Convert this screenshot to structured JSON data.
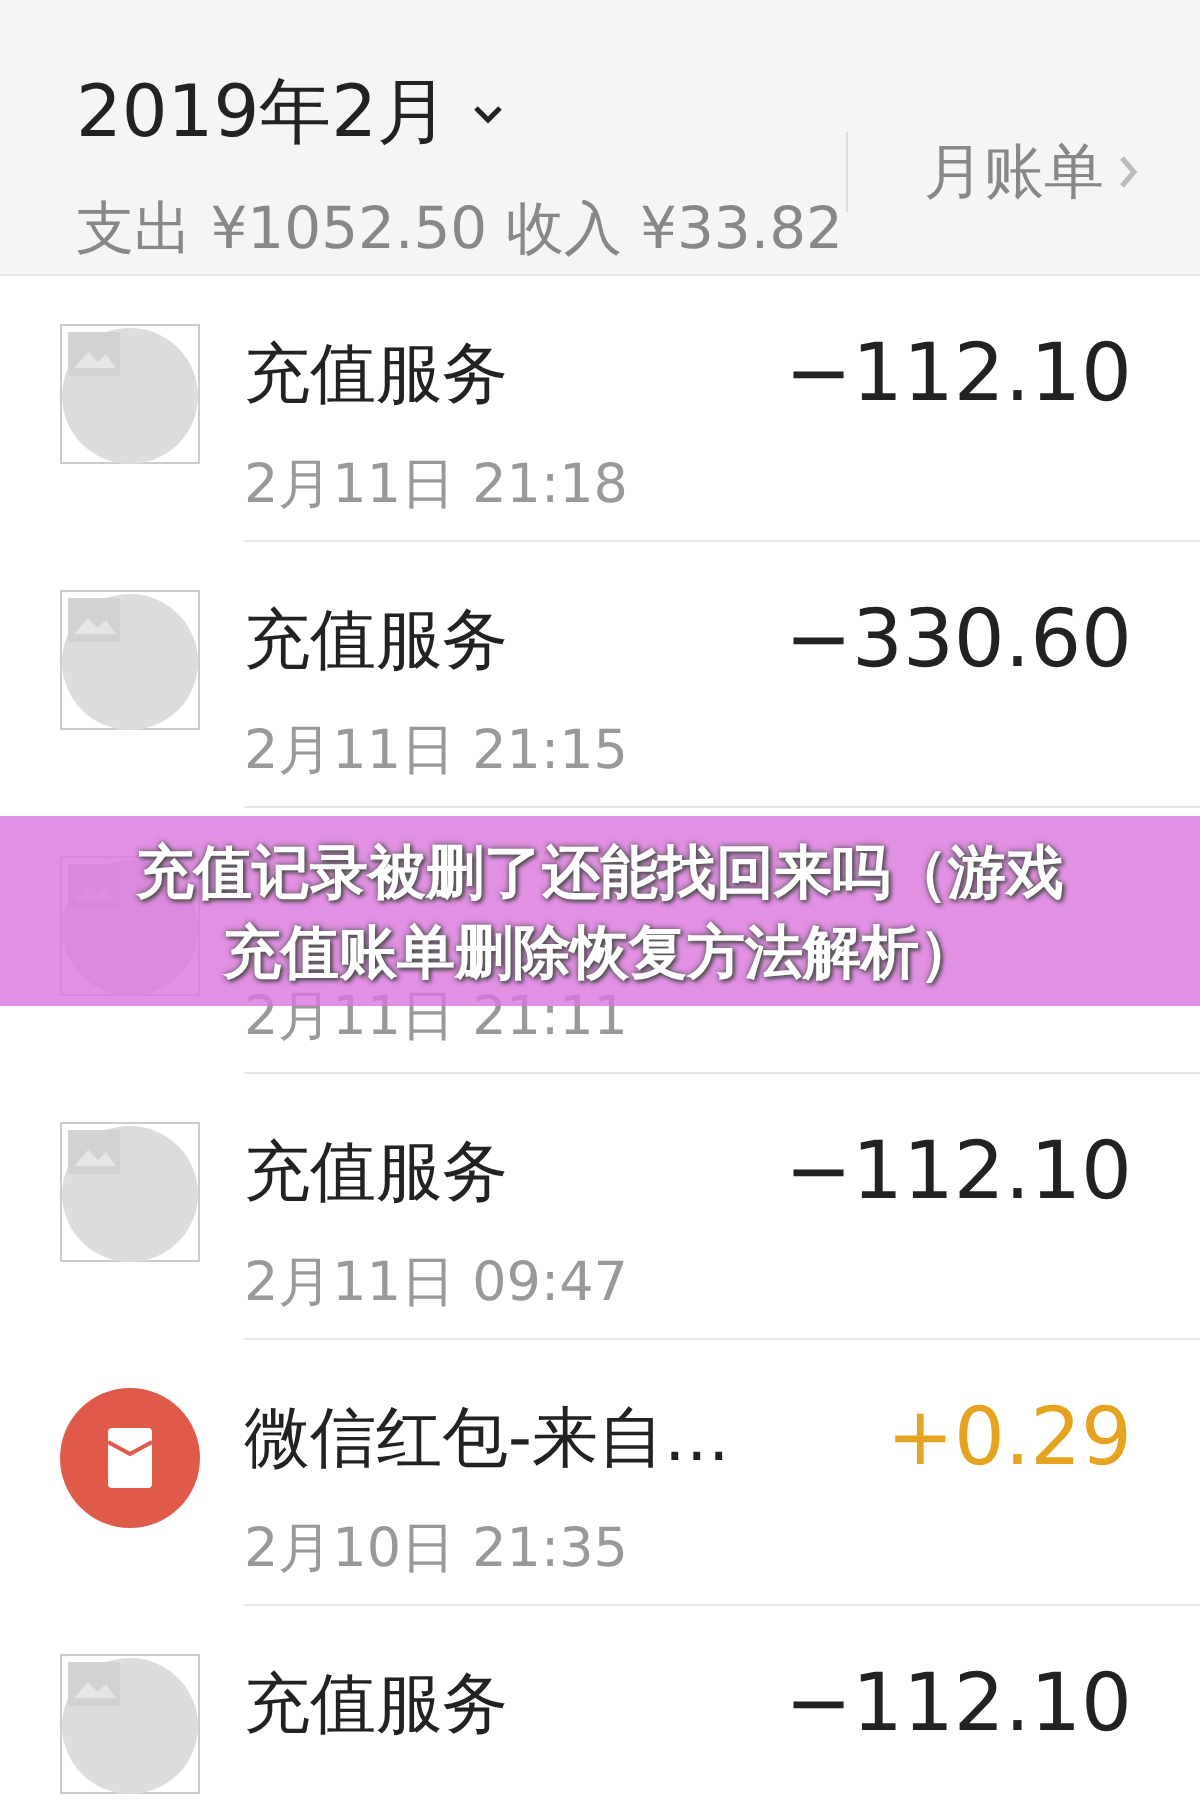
{
  "header": {
    "month": "2019年2月",
    "summary": "支出 ¥1052.50 收入 ¥33.82",
    "monthly_bill": "月账单"
  },
  "rows": [
    {
      "kind": "placeholder",
      "income": false,
      "title": "充值服务",
      "time": "2月11日 21:18",
      "amount": "−112.10"
    },
    {
      "kind": "placeholder",
      "income": false,
      "title": "充值服务",
      "time": "2月11日 21:15",
      "amount": "−330.60"
    },
    {
      "kind": "placeholder",
      "time": "2月11日 21:11"
    },
    {
      "kind": "placeholder",
      "income": false,
      "title": "充值服务",
      "time": "2月11日 09:47",
      "amount": "−112.10"
    },
    {
      "kind": "red-packet",
      "income": true,
      "title": "微信红包-来自…",
      "time": "2月10日 21:35",
      "amount": "+0.29"
    },
    {
      "kind": "placeholder",
      "income": false,
      "title": "充值服务",
      "amount": "−112.10"
    }
  ],
  "banner": {
    "lines": [
      "充值记录被删了还能找回来吗（游戏",
      "充值账单删除恢复方法解析）"
    ]
  }
}
